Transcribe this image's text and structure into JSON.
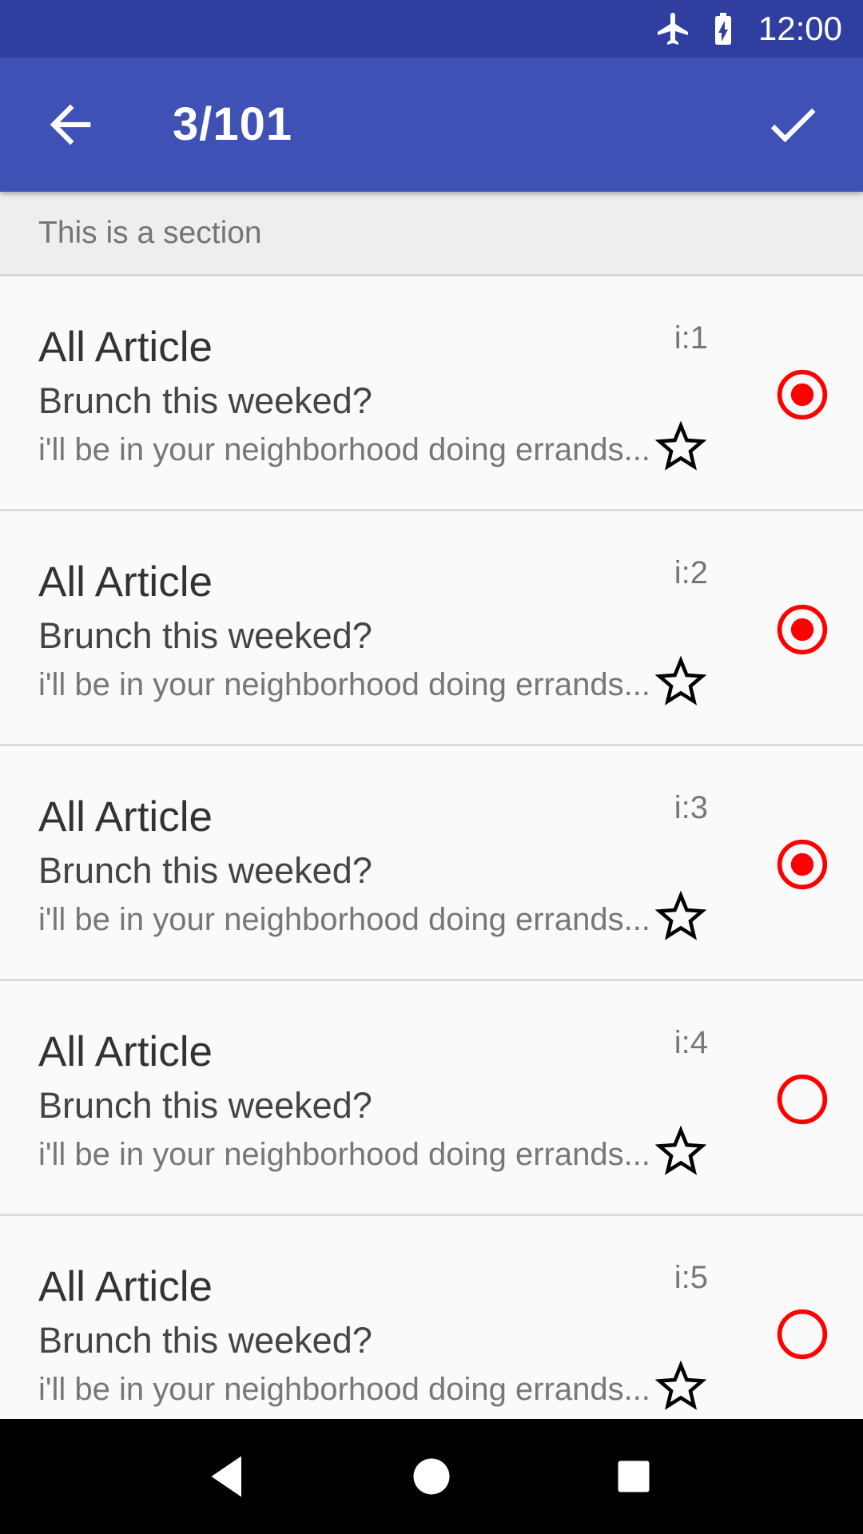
{
  "status_bar": {
    "time": "12:00",
    "icons": [
      "airplane-mode-icon",
      "battery-charging-icon"
    ]
  },
  "app_bar": {
    "title": "3/101",
    "back_icon": "arrow-back-icon",
    "done_icon": "check-icon"
  },
  "section": {
    "label": "This is a section"
  },
  "colors": {
    "status_bar": "#303f9f",
    "app_bar": "#3f51b5",
    "radio_accent": "#ff0000"
  },
  "items": [
    {
      "title": "All Article",
      "subject": "Brunch this weeked?",
      "snippet": "i'll be in your neighborhood doing errands...",
      "index": "i:1",
      "selected": true
    },
    {
      "title": "All Article",
      "subject": "Brunch this weeked?",
      "snippet": "i'll be in your neighborhood doing errands...",
      "index": "i:2",
      "selected": true
    },
    {
      "title": "All Article",
      "subject": "Brunch this weeked?",
      "snippet": "i'll be in your neighborhood doing errands...",
      "index": "i:3",
      "selected": true
    },
    {
      "title": "All Article",
      "subject": "Brunch this weeked?",
      "snippet": "i'll be in your neighborhood doing errands...",
      "index": "i:4",
      "selected": false
    },
    {
      "title": "All Article",
      "subject": "Brunch this weeked?",
      "snippet": "i'll be in your neighborhood doing errands...",
      "index": "i:5",
      "selected": false
    }
  ],
  "nav_bar": {
    "icons": [
      "nav-back-icon",
      "nav-home-icon",
      "nav-recents-icon"
    ]
  }
}
